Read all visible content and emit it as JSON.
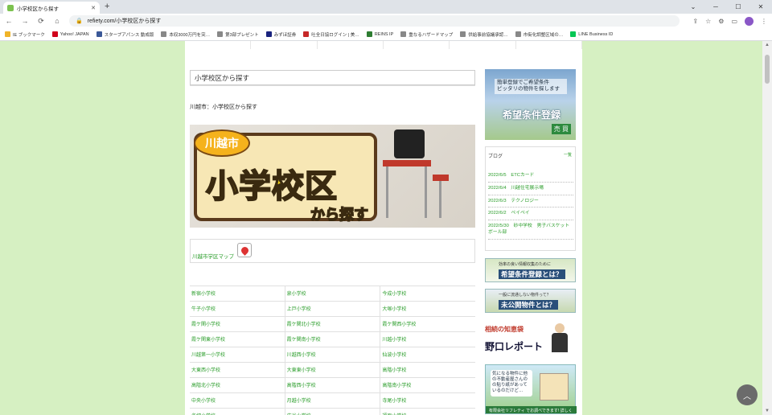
{
  "browser": {
    "tab_title": "小学校区から探す",
    "tab_close": "✕",
    "new_tab": "+",
    "window_controls": [
      "⌄",
      "─",
      "☐",
      "✕"
    ],
    "url": "refiety.com/小学校区から探す",
    "nav": {
      "back": "←",
      "forward": "→",
      "reload": "⟳",
      "home": "⌂"
    },
    "toolbar_icons": {
      "share": "⇪",
      "star": "☆",
      "puzzle": "⚙",
      "panel": "▭",
      "menu": "⋮"
    },
    "profile_initial": "●",
    "bookmarks": [
      {
        "label": "IE ブックマーク",
        "color": "#f0b429"
      },
      {
        "label": "Yahoo! JAPAN",
        "color": "#d0021b"
      },
      {
        "label": "スタープアパンス 動成版",
        "color": "#3b5998"
      },
      {
        "label": "本収3000万円を突…",
        "color": "#888888"
      },
      {
        "label": "第3部プレゼント",
        "color": "#888888"
      },
      {
        "label": "みずほ証券",
        "color": "#1a237e"
      },
      {
        "label": "吐全日協ログイン | 美…",
        "color": "#c62828"
      },
      {
        "label": "REINS IP",
        "color": "#2e7d32"
      },
      {
        "label": "重なるハザードマップ",
        "color": "#888888"
      },
      {
        "label": "供給事前協議承認…",
        "color": "#888888"
      },
      {
        "label": "市街化調整区域の…",
        "color": "#888888"
      },
      {
        "label": "LINE Business ID",
        "color": "#06c755"
      }
    ]
  },
  "main": {
    "heading": "小学校区から探す",
    "subheading": "川越市：小学校区から探す",
    "banner": {
      "city": "川越市",
      "title": "小学校区",
      "subtitle": "から探す"
    },
    "map_link": "川越市学区マップ",
    "schools": [
      [
        "新宿小学校",
        "泉小学校",
        "今成小学校"
      ],
      [
        "牛子小学校",
        "上戸小学校",
        "大塚小学校"
      ],
      [
        "霞ケ関小学校",
        "霞ケ関北小学校",
        "霞ケ関西小学校"
      ],
      [
        "霞ケ関東小学校",
        "霞ケ関南小学校",
        "川越小学校"
      ],
      [
        "川越第一小学校",
        "川越西小学校",
        "仙波小学校"
      ],
      [
        "大東西小学校",
        "大東東小学校",
        "高階小学校"
      ],
      [
        "高階北小学校",
        "高階西小学校",
        "高階南小学校"
      ],
      [
        "中央小学校",
        "月越小学校",
        "寺尾小学校"
      ],
      [
        "名細小学校",
        "広谷小学校",
        "福原小学校"
      ]
    ]
  },
  "sidebar": {
    "ad_register": {
      "line1": "簡単登録でご希望条件",
      "line2": "ピッタリの物件を探します",
      "title": "希望条件登録",
      "tag": "売 買"
    },
    "blog": {
      "title": "ブログ",
      "more": "一覧",
      "posts": [
        "2022/6/5　ETCカード",
        "2022/6/4　川越住宅展示場",
        "2022/6/3　テクノロジー",
        "2022/6/2　ペイペイ",
        "2022/5/30　砂中学校　男子バスケットボール部"
      ]
    },
    "ad_info": {
      "small": "効率の良い情報収集のために",
      "big": "希望条件登録とは？"
    },
    "ad_unpublished": {
      "small": "一般に流通しない物件って？",
      "big": "未公開物件とは？"
    },
    "ad_noguchi": {
      "line1": "相続の知恵袋",
      "line2": "野口レポート"
    },
    "ad_realty": {
      "text": "気になる物件に他の不動産屋さんのの貼り紙があっているのだけど…",
      "bar": "有限会社リフレティ でお調べできます! 詳しく◎"
    }
  },
  "fab": "︿"
}
